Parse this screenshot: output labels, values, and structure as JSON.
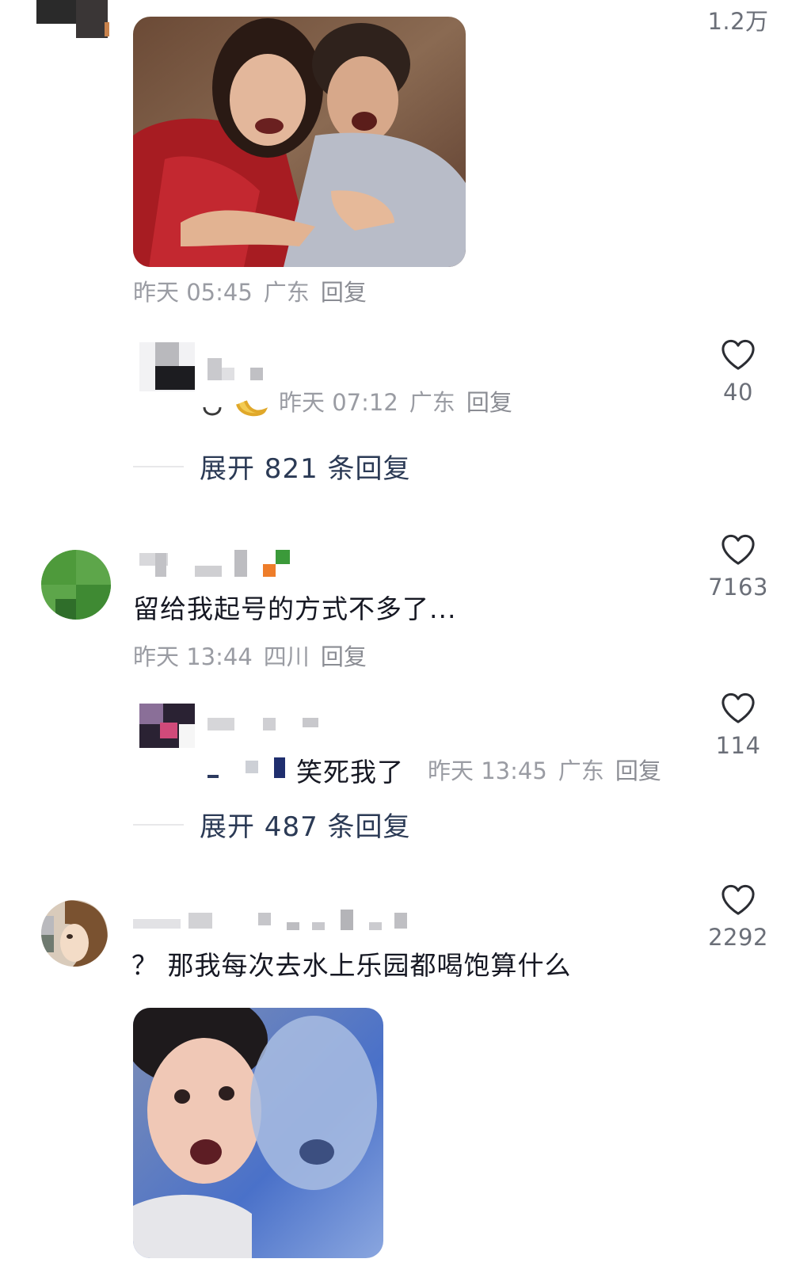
{
  "comments": [
    {
      "like_count": "1.2万",
      "image_alt": "剧照表情包",
      "meta": {
        "time": "昨天 05:45",
        "location": "广东",
        "reply": "回复"
      }
    },
    {
      "text": "留给我起号的方式不多了...",
      "like_count": "7163",
      "meta": {
        "time": "昨天 13:44",
        "location": "四川",
        "reply": "回复"
      }
    },
    {
      "text": "？ 那我每次去水上乐园都喝饱算什么",
      "like_count": "2292",
      "image_alt": "惊讶表情包"
    }
  ],
  "replies": [
    {
      "like_count": "40",
      "meta": {
        "time": "昨天 07:12",
        "location": "广东",
        "reply": "回复"
      },
      "expand_label": "展开 821 条回复"
    },
    {
      "text": "笑死我了",
      "like_count": "114",
      "meta": {
        "time": "昨天 13:45",
        "location": "广东",
        "reply": "回复"
      },
      "expand_label": "展开 487 条回复"
    }
  ],
  "colors": {
    "text_primary": "#161823",
    "text_meta": "#9a9ca3",
    "expand_text": "#2b3a55",
    "like_icon": "#2b2d33"
  },
  "icons": {
    "like": "heart-outline-icon"
  }
}
